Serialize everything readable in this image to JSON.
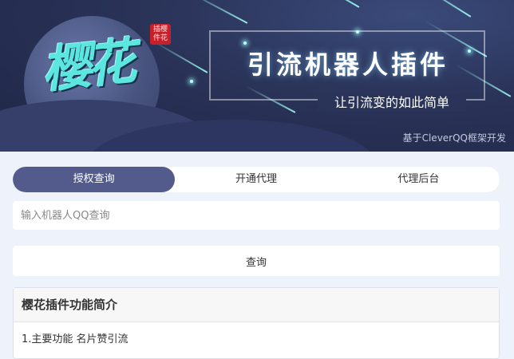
{
  "banner": {
    "logo_text": "樱花",
    "seal_text": "插樱件花",
    "title": "引流机器人插件",
    "subtitle": "让引流变的如此简单",
    "credit": "基于CleverQQ框架开发"
  },
  "tabs": [
    {
      "label": "授权查询",
      "active": true
    },
    {
      "label": "开通代理",
      "active": false
    },
    {
      "label": "代理后台",
      "active": false
    }
  ],
  "search": {
    "placeholder": "输入机器人QQ查询",
    "value": ""
  },
  "query_button": "查询",
  "panel": {
    "title": "樱花插件功能简介",
    "items": [
      "1.主要功能 名片赞引流"
    ]
  },
  "colors": {
    "accent": "#525b8b",
    "banner_bg": "#2a3358",
    "brush": "#5ce6e0",
    "seal": "#c8202a"
  }
}
